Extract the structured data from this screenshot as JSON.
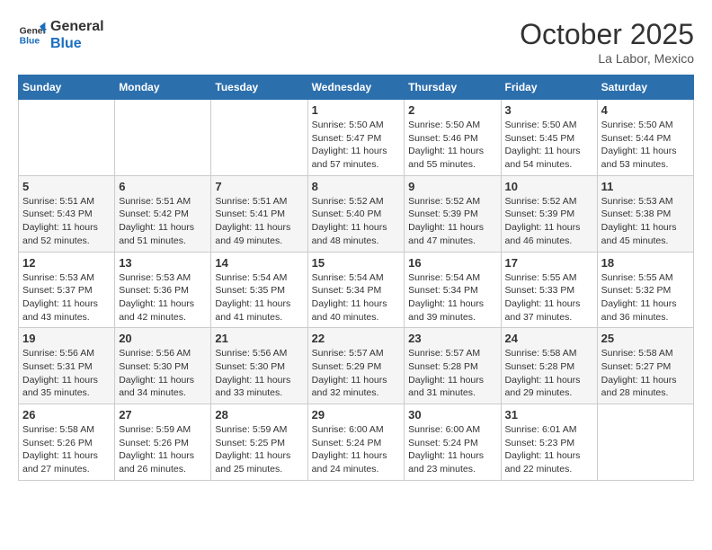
{
  "header": {
    "logo_line1": "General",
    "logo_line2": "Blue",
    "month": "October 2025",
    "location": "La Labor, Mexico"
  },
  "days_of_week": [
    "Sunday",
    "Monday",
    "Tuesday",
    "Wednesday",
    "Thursday",
    "Friday",
    "Saturday"
  ],
  "weeks": [
    [
      {
        "day": "",
        "info": ""
      },
      {
        "day": "",
        "info": ""
      },
      {
        "day": "",
        "info": ""
      },
      {
        "day": "1",
        "info": "Sunrise: 5:50 AM\nSunset: 5:47 PM\nDaylight: 11 hours and 57 minutes."
      },
      {
        "day": "2",
        "info": "Sunrise: 5:50 AM\nSunset: 5:46 PM\nDaylight: 11 hours and 55 minutes."
      },
      {
        "day": "3",
        "info": "Sunrise: 5:50 AM\nSunset: 5:45 PM\nDaylight: 11 hours and 54 minutes."
      },
      {
        "day": "4",
        "info": "Sunrise: 5:50 AM\nSunset: 5:44 PM\nDaylight: 11 hours and 53 minutes."
      }
    ],
    [
      {
        "day": "5",
        "info": "Sunrise: 5:51 AM\nSunset: 5:43 PM\nDaylight: 11 hours and 52 minutes."
      },
      {
        "day": "6",
        "info": "Sunrise: 5:51 AM\nSunset: 5:42 PM\nDaylight: 11 hours and 51 minutes."
      },
      {
        "day": "7",
        "info": "Sunrise: 5:51 AM\nSunset: 5:41 PM\nDaylight: 11 hours and 49 minutes."
      },
      {
        "day": "8",
        "info": "Sunrise: 5:52 AM\nSunset: 5:40 PM\nDaylight: 11 hours and 48 minutes."
      },
      {
        "day": "9",
        "info": "Sunrise: 5:52 AM\nSunset: 5:39 PM\nDaylight: 11 hours and 47 minutes."
      },
      {
        "day": "10",
        "info": "Sunrise: 5:52 AM\nSunset: 5:39 PM\nDaylight: 11 hours and 46 minutes."
      },
      {
        "day": "11",
        "info": "Sunrise: 5:53 AM\nSunset: 5:38 PM\nDaylight: 11 hours and 45 minutes."
      }
    ],
    [
      {
        "day": "12",
        "info": "Sunrise: 5:53 AM\nSunset: 5:37 PM\nDaylight: 11 hours and 43 minutes."
      },
      {
        "day": "13",
        "info": "Sunrise: 5:53 AM\nSunset: 5:36 PM\nDaylight: 11 hours and 42 minutes."
      },
      {
        "day": "14",
        "info": "Sunrise: 5:54 AM\nSunset: 5:35 PM\nDaylight: 11 hours and 41 minutes."
      },
      {
        "day": "15",
        "info": "Sunrise: 5:54 AM\nSunset: 5:34 PM\nDaylight: 11 hours and 40 minutes."
      },
      {
        "day": "16",
        "info": "Sunrise: 5:54 AM\nSunset: 5:34 PM\nDaylight: 11 hours and 39 minutes."
      },
      {
        "day": "17",
        "info": "Sunrise: 5:55 AM\nSunset: 5:33 PM\nDaylight: 11 hours and 37 minutes."
      },
      {
        "day": "18",
        "info": "Sunrise: 5:55 AM\nSunset: 5:32 PM\nDaylight: 11 hours and 36 minutes."
      }
    ],
    [
      {
        "day": "19",
        "info": "Sunrise: 5:56 AM\nSunset: 5:31 PM\nDaylight: 11 hours and 35 minutes."
      },
      {
        "day": "20",
        "info": "Sunrise: 5:56 AM\nSunset: 5:30 PM\nDaylight: 11 hours and 34 minutes."
      },
      {
        "day": "21",
        "info": "Sunrise: 5:56 AM\nSunset: 5:30 PM\nDaylight: 11 hours and 33 minutes."
      },
      {
        "day": "22",
        "info": "Sunrise: 5:57 AM\nSunset: 5:29 PM\nDaylight: 11 hours and 32 minutes."
      },
      {
        "day": "23",
        "info": "Sunrise: 5:57 AM\nSunset: 5:28 PM\nDaylight: 11 hours and 31 minutes."
      },
      {
        "day": "24",
        "info": "Sunrise: 5:58 AM\nSunset: 5:28 PM\nDaylight: 11 hours and 29 minutes."
      },
      {
        "day": "25",
        "info": "Sunrise: 5:58 AM\nSunset: 5:27 PM\nDaylight: 11 hours and 28 minutes."
      }
    ],
    [
      {
        "day": "26",
        "info": "Sunrise: 5:58 AM\nSunset: 5:26 PM\nDaylight: 11 hours and 27 minutes."
      },
      {
        "day": "27",
        "info": "Sunrise: 5:59 AM\nSunset: 5:26 PM\nDaylight: 11 hours and 26 minutes."
      },
      {
        "day": "28",
        "info": "Sunrise: 5:59 AM\nSunset: 5:25 PM\nDaylight: 11 hours and 25 minutes."
      },
      {
        "day": "29",
        "info": "Sunrise: 6:00 AM\nSunset: 5:24 PM\nDaylight: 11 hours and 24 minutes."
      },
      {
        "day": "30",
        "info": "Sunrise: 6:00 AM\nSunset: 5:24 PM\nDaylight: 11 hours and 23 minutes."
      },
      {
        "day": "31",
        "info": "Sunrise: 6:01 AM\nSunset: 5:23 PM\nDaylight: 11 hours and 22 minutes."
      },
      {
        "day": "",
        "info": ""
      }
    ]
  ]
}
